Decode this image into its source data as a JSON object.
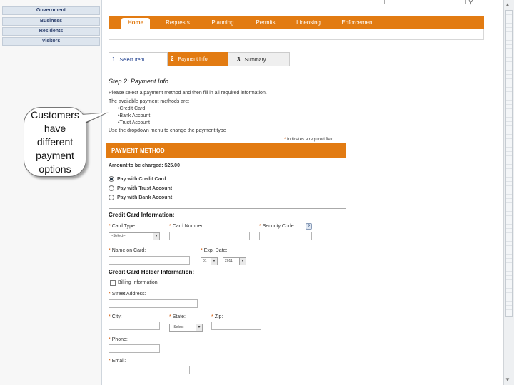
{
  "sidebar": {
    "items": [
      "Government",
      "Business",
      "Residents",
      "Visitors"
    ]
  },
  "callout": {
    "lines": [
      "Customers",
      "have",
      "different",
      "payment",
      "options"
    ]
  },
  "nav": {
    "items": [
      "Home",
      "Requests",
      "Planning",
      "Permits",
      "Licensing",
      "Enforcement"
    ],
    "active": "Home"
  },
  "steps": [
    {
      "num": "1",
      "label": "Select Item..."
    },
    {
      "num": "2",
      "label": "Payment Info"
    },
    {
      "num": "3",
      "label": "Summary"
    }
  ],
  "step_heading": "Step 2: Payment Info",
  "instructions": {
    "line1": "Please select a payment method and then fill in all required information.",
    "line2": "The available payment methods are:",
    "methods": [
      "•Credit Card",
      "•Bank Account",
      "•Trust Account"
    ],
    "line3": "Use the dropdown menu to change the payment type"
  },
  "required_note": {
    "star": "*",
    "text": " Indicates a required field"
  },
  "payment_method_title": "PAYMENT METHOD",
  "amount_label": "Amount to be charged: $25.00",
  "payment_options": [
    {
      "label": "Pay with Credit Card",
      "checked": true
    },
    {
      "label": "Pay with Trust Account",
      "checked": false
    },
    {
      "label": "Pay with Bank Account",
      "checked": false
    }
  ],
  "credit_card": {
    "title": "Credit Card Information:",
    "card_type_label": "Card Type:",
    "card_type_value": "--Select--",
    "card_number_label": "Card Number:",
    "security_code_label": "Security Code:",
    "help_icon": "?",
    "name_label": "Name on Card:",
    "exp_label": "Exp. Date:",
    "exp_month": "01",
    "exp_year": "2011"
  },
  "holder": {
    "title": "Credit Card Holder Information:",
    "billing_label": "Billing Information",
    "street_label": "Street Address:",
    "city_label": "City:",
    "state_label": "State:",
    "state_value": "--Select--",
    "zip_label": "Zip:",
    "phone_label": "Phone:",
    "email_label": "Email:"
  },
  "star": "*"
}
